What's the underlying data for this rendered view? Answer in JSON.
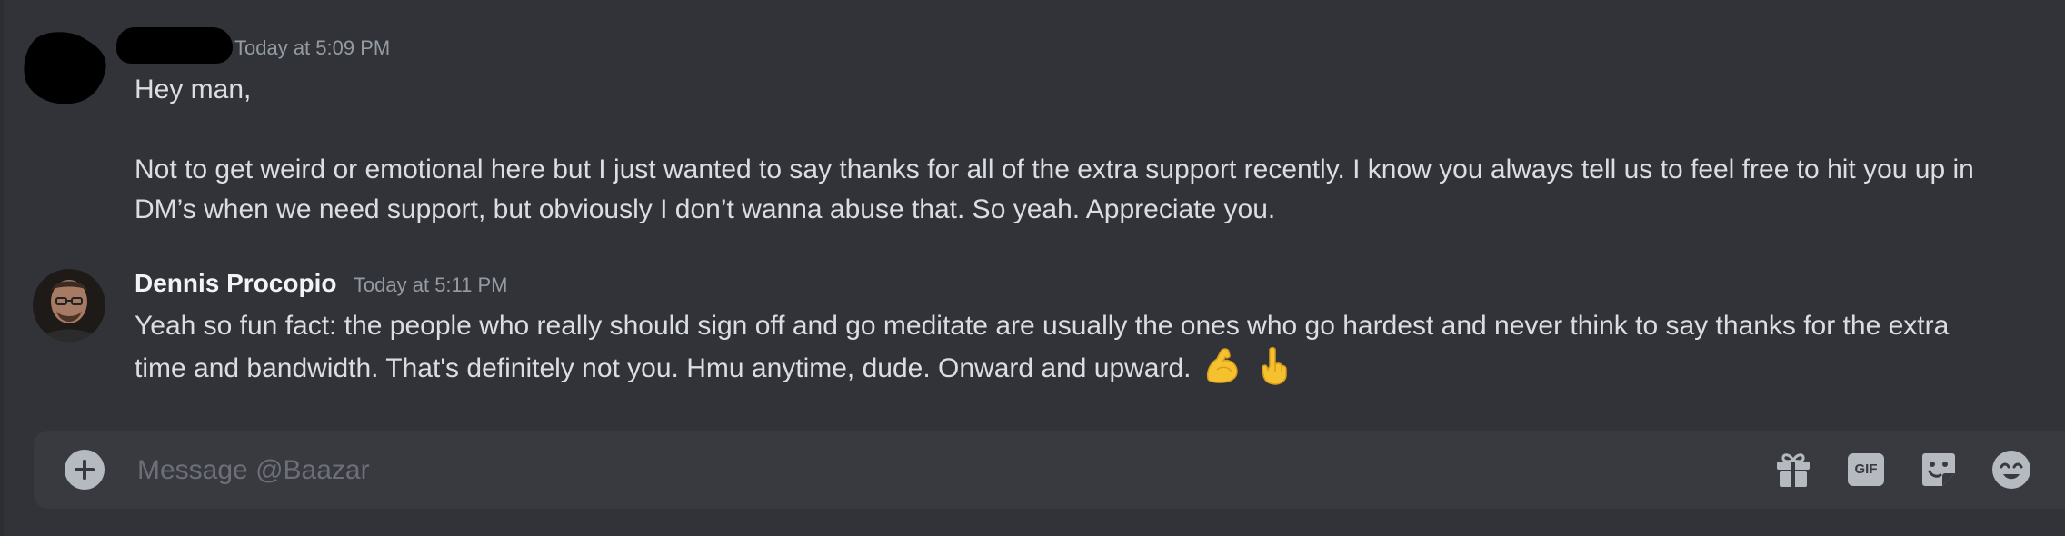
{
  "messages": [
    {
      "author": "",
      "timestamp": "Today at 5:09 PM",
      "paragraphs": [
        "Hey man,",
        "Not to get weird or emotional here but I just wanted to say thanks for all of the extra support recently. I know you always tell us to feel free to hit you up in DM’s when we need support, but obviously I don’t wanna abuse that. So yeah. Appreciate you."
      ]
    },
    {
      "author": "Dennis Procopio",
      "timestamp": "Today at 5:11 PM",
      "text": "Yeah so fun fact: the people who really should sign off and go meditate are usually the ones who go hardest and never think to say thanks for the extra time and bandwidth. That's definitely not you. Hmu anytime, dude. Onward and upward.",
      "emojis": [
        "flexed-biceps-emoji",
        "index-pointing-up-emoji"
      ]
    }
  ],
  "composer": {
    "placeholder": "Message @Baazar",
    "buttons": [
      "add-attachment-icon",
      "gift-icon",
      "gif-icon",
      "sticker-icon",
      "emoji-icon"
    ],
    "gif_label": "GIF"
  },
  "colors": {
    "background": "#313338",
    "composer": "#383a40",
    "text": "#dbdee1",
    "muted": "#949ba4",
    "icon": "#b5bac1",
    "emoji": "#f6c12f"
  }
}
